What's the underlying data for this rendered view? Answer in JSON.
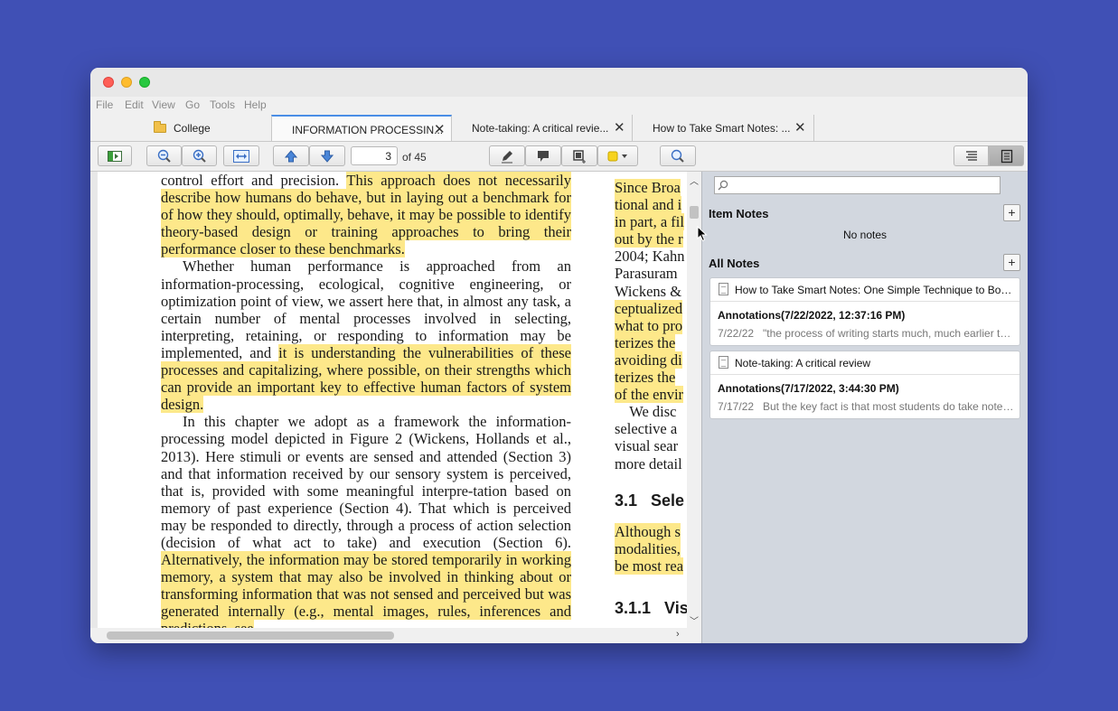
{
  "menu": [
    "File",
    "Edit",
    "View",
    "Go",
    "Tools",
    "Help"
  ],
  "tabs": {
    "library": "College",
    "items": [
      {
        "label": "INFORMATION PROCESSIN..."
      },
      {
        "label": "Note-taking: A critical revie..."
      },
      {
        "label": "How to Take Smart Notes: ..."
      }
    ],
    "close_glyph": "✕"
  },
  "toolbar": {
    "page_number": "3",
    "page_total": "of 45",
    "highlight_color": "#f7d31f"
  },
  "document": {
    "col1_paragraphs": [
      [
        {
          "t": "control effort and precision. ",
          "h": false
        },
        {
          "t": "This approach does not necessarily describe how humans do behave, but in laying out a benchmark for of how they should, optimally, behave, it may be possible to identify theory-based design or training approaches to bring their performance closer to these benchmarks.",
          "h": true
        }
      ],
      [
        {
          "t": "Whether human performance is approached from an information-processing, ecological, cognitive engineering, or optimization point of view, we assert here that, in almost any task, a certain number of mental processes involved in selecting, interpreting, retaining, or responding to information may be implemented, and ",
          "h": false
        },
        {
          "t": "it is understanding the vulnerabilities of these processes and capitalizing, where possible, on their strengths which can provide an important key to effective human factors of system design.",
          "h": true
        }
      ],
      [
        {
          "t": "In this chapter we adopt as a framework the information-processing model depicted in Figure 2 (Wickens, Hollands et al., 2013). Here stimuli or events are sensed and attended (Section 3) and that information received by our sensory system is perceived, that is, provided with some meaningful interpre-tation based on memory of past experience (Section 4). That which is perceived may be responded to directly, through a process of action selection (decision of what act to take) and execution (Section 6). ",
          "h": false
        },
        {
          "t": "Alternatively, the information may be stored temporarily in working memory, a system that may also be involved in thinking about or transforming information that was not sensed and perceived but was generated internally (e.g., mental images, rules, inferences and predictions, see",
          "h": true
        }
      ]
    ],
    "col2_lines": [
      {
        "t": "Since Broa",
        "h": true
      },
      {
        "t": "tional and i",
        "h": true
      },
      {
        "t": "in part, a fil",
        "h": true
      },
      {
        "t": "out by the r",
        "h": true
      },
      {
        "t": "2004; Kahn",
        "h": false
      },
      {
        "t": "Parasuram",
        "h": false
      },
      {
        "t": "Wickens &",
        "h": false
      },
      {
        "t": "ceptualized",
        "h": true
      },
      {
        "t": "what to pro",
        "h": true
      },
      {
        "t": "terizes the",
        "h": true
      },
      {
        "t": "avoiding di",
        "h": true
      },
      {
        "t": "terizes the",
        "h": true
      },
      {
        "t": "of the envir",
        "h": true
      },
      {
        "t": "    We disc",
        "h": false
      },
      {
        "t": "selective a",
        "h": false
      },
      {
        "t": "visual sear",
        "h": false
      },
      {
        "t": "more detail",
        "h": false
      }
    ],
    "heading_31": "3.1   Sele",
    "col2_lines_b": [
      {
        "t": "Although s",
        "h": true
      },
      {
        "t": "modalities,",
        "h": true
      },
      {
        "t": "be most rea",
        "h": true
      }
    ],
    "heading_311": "3.1.1   Vis"
  },
  "sidebar": {
    "search_placeholder": "",
    "item_notes_title": "Item Notes",
    "no_notes": "No notes",
    "all_notes_title": "All Notes",
    "add_glyph": "+",
    "notes": [
      {
        "title": "How to Take Smart Notes: One Simple Technique to Boost Writing, Learning and Thinking",
        "annotation": "Annotations(7/22/2022, 12:37:16 PM)",
        "date": "7/22/22",
        "snippet": "\"the process of writing starts much, much earlier than that\""
      },
      {
        "title": "Note-taking: A critical review",
        "annotation": "Annotations(7/17/2022, 3:44:30 PM)",
        "date": "7/17/22",
        "snippet": "But the key fact is that most students do take notes during lectures"
      }
    ]
  }
}
